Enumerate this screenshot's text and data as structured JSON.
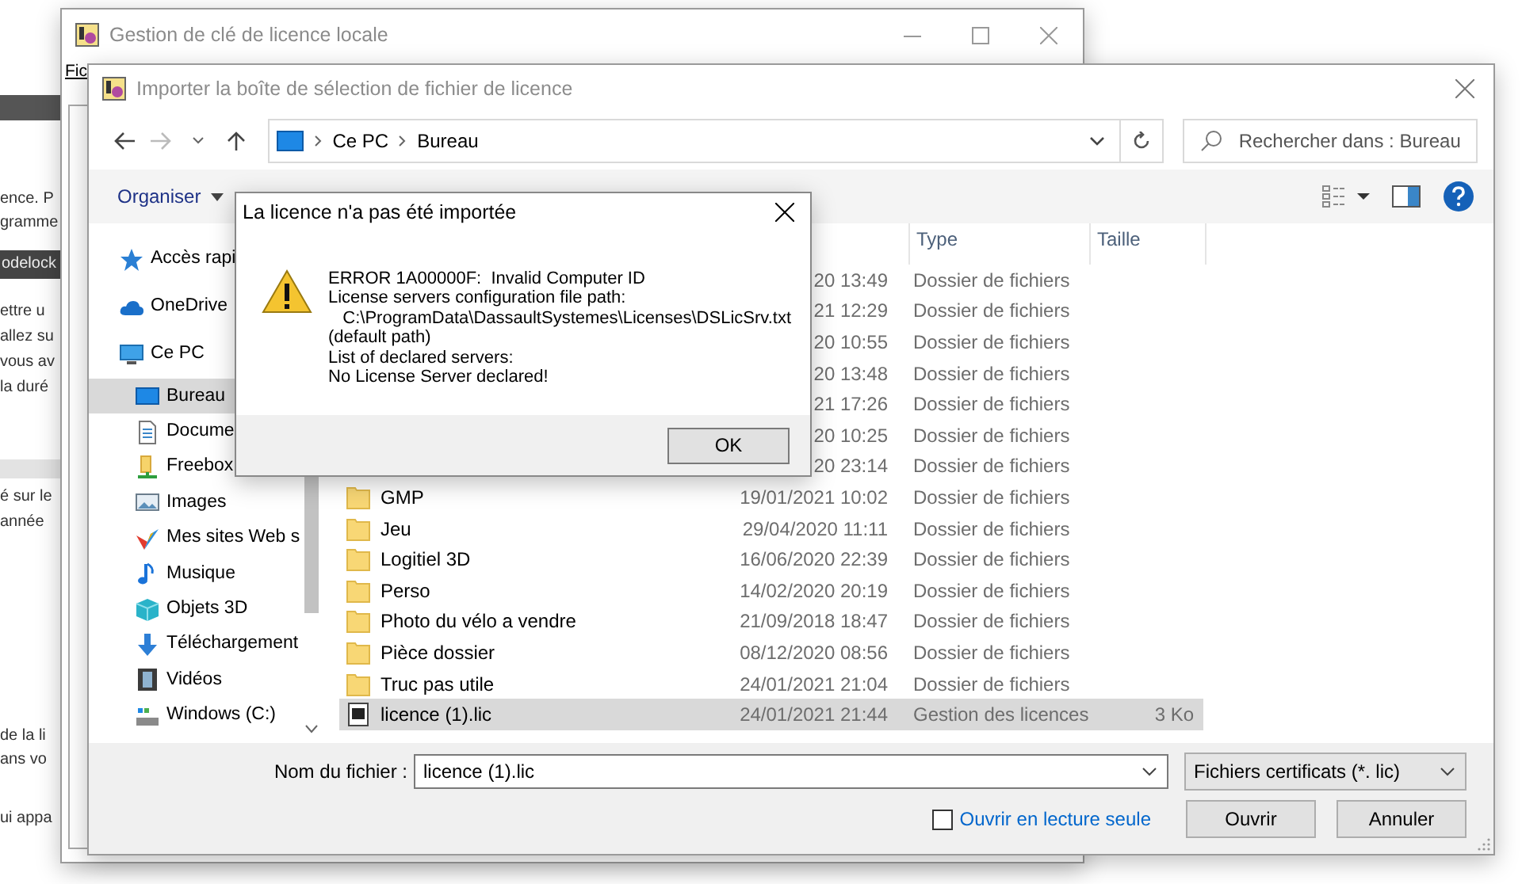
{
  "background_page": {
    "fragments": [
      {
        "text": "ence. P",
        "kind": "text"
      },
      {
        "text": "gramme",
        "kind": "text"
      },
      {
        "text": "odelock",
        "kind": "banner"
      },
      {
        "text": "ettre u",
        "kind": "text"
      },
      {
        "text": "allez su",
        "kind": "text"
      },
      {
        "text": "vous av",
        "kind": "text"
      },
      {
        "text": "la duré",
        "kind": "text"
      },
      {
        "text": "é sur le",
        "kind": "text"
      },
      {
        "text": "année",
        "kind": "text"
      },
      {
        "text": "de la li",
        "kind": "text"
      },
      {
        "text": "ans vo",
        "kind": "text"
      },
      {
        "text": "ui appa",
        "kind": "text"
      }
    ]
  },
  "main_window": {
    "title": "Gestion de clé de licence locale",
    "menu": [
      "Fic"
    ]
  },
  "file_dialog": {
    "title": "Importer la boîte de sélection de fichier de licence",
    "breadcrumb": [
      "Ce PC",
      "Bureau"
    ],
    "search": {
      "placeholder": "Rechercher dans : Bureau"
    },
    "organize": "Organiser",
    "nav_items": [
      {
        "label": "Accès rapi",
        "kind": "quick",
        "selected": false
      },
      {
        "label": "OneDrive",
        "kind": "cloud",
        "selected": false
      },
      {
        "label": "Ce PC",
        "kind": "pc",
        "selected": false,
        "children": [
          {
            "label": "Bureau",
            "kind": "desktop",
            "selected": true
          },
          {
            "label": "Docume",
            "kind": "documents",
            "selected": false
          },
          {
            "label": "Freebox",
            "kind": "network",
            "selected": false
          },
          {
            "label": "Images",
            "kind": "images",
            "selected": false
          },
          {
            "label": "Mes sites Web s",
            "kind": "web",
            "selected": false
          },
          {
            "label": "Musique",
            "kind": "music",
            "selected": false
          },
          {
            "label": "Objets 3D",
            "kind": "objects",
            "selected": false
          },
          {
            "label": "Téléchargement",
            "kind": "downloads",
            "selected": false
          },
          {
            "label": "Vidéos",
            "kind": "videos",
            "selected": false
          },
          {
            "label": "Windows (C:)",
            "kind": "drive",
            "selected": false
          }
        ]
      }
    ],
    "columns": [
      "Type",
      "Taille"
    ],
    "files": [
      {
        "date": "20 13:49",
        "type": "Dossier de fichiers",
        "selected": false
      },
      {
        "date": "21 12:29",
        "type": "Dossier de fichiers",
        "selected": false
      },
      {
        "date": "20 10:55",
        "type": "Dossier de fichiers",
        "selected": false
      },
      {
        "date": "20 13:48",
        "type": "Dossier de fichiers",
        "selected": false
      },
      {
        "date": "21 17:26",
        "type": "Dossier de fichiers",
        "selected": false
      },
      {
        "date": "20 10:25",
        "type": "Dossier de fichiers",
        "selected": false
      },
      {
        "date": "20 23:14",
        "type": "Dossier de fichiers",
        "selected": false
      },
      {
        "kind": "folder",
        "name": "GMP",
        "date": "19/01/2021 10:02",
        "type": "Dossier de fichiers",
        "selected": false
      },
      {
        "kind": "folder",
        "name": "Jeu",
        "date": "29/04/2020 11:11",
        "type": "Dossier de fichiers",
        "selected": false
      },
      {
        "kind": "folder",
        "name": "Logitiel 3D",
        "date": "16/06/2020 22:39",
        "type": "Dossier de fichiers",
        "selected": false
      },
      {
        "kind": "folder",
        "name": "Perso",
        "date": "14/02/2020 20:19",
        "type": "Dossier de fichiers",
        "selected": false
      },
      {
        "kind": "folder",
        "name": "Photo du vélo a vendre",
        "date": "21/09/2018 18:47",
        "type": "Dossier de fichiers",
        "selected": false
      },
      {
        "kind": "folder",
        "name": "Pièce dossier",
        "date": "08/12/2020 08:56",
        "type": "Dossier de fichiers",
        "selected": false
      },
      {
        "kind": "folder",
        "name": "Truc pas utile",
        "date": "24/01/2021 21:04",
        "type": "Dossier de fichiers",
        "selected": false
      },
      {
        "kind": "license",
        "name": "licence (1).lic",
        "date": "24/01/2021 21:44",
        "type": "Gestion des licences",
        "size": "3 Ko",
        "selected": true
      }
    ],
    "filename_label": "Nom du fichier :",
    "filename": "licence (1).lic",
    "filter": "Fichiers certificats (*. lic)",
    "read_only": {
      "label": "Ouvrir en lecture seule",
      "checked": false
    },
    "buttons": [
      "Ouvrir",
      "Annuler"
    ]
  },
  "message_box": {
    "title": "La licence n'a pas été importée",
    "text": "ERROR 1A00000F:  Invalid Computer ID\nLicense servers configuration file path:\n   C:\\ProgramData\\DassaultSystemes\\Licenses\\DSLicSrv.txt\n(default path)\nList of declared servers:\nNo License Server declared!",
    "button": "OK"
  }
}
